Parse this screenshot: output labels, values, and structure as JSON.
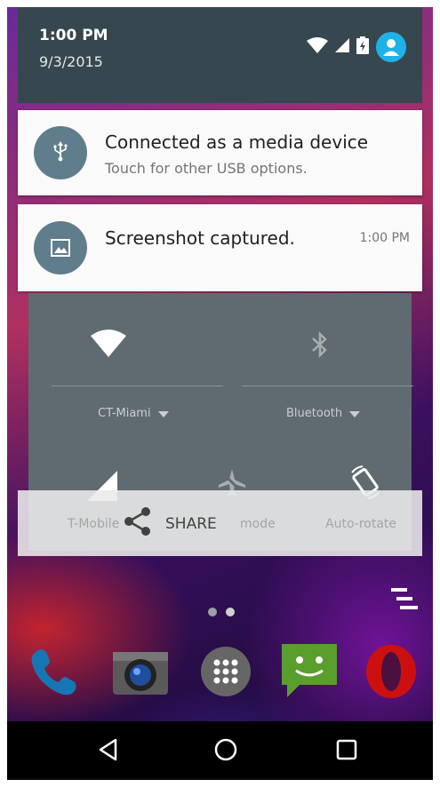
{
  "status": {
    "time": "1:00 PM",
    "date": "9/3/2015",
    "icons": [
      "wifi-icon",
      "cell-signal-icon",
      "battery-icon",
      "user-avatar-icon"
    ]
  },
  "notifications": [
    {
      "icon": "usb-icon",
      "title": "Connected as a media device",
      "subtitle": "Touch for other USB options."
    },
    {
      "icon": "image-icon",
      "title": "Screenshot captured.",
      "time": "1:00 PM"
    }
  ],
  "quick_settings": {
    "wifi_label": "CT-Miami",
    "bluetooth_label": "Bluetooth",
    "cellular_label": "T-Mobile",
    "airplane_label": "mode",
    "rotate_label": "Auto-rotate"
  },
  "share": {
    "label": "SHARE"
  },
  "dock": [
    "phone-app-icon",
    "camera-app-icon",
    "app-drawer-icon",
    "messaging-app-icon",
    "opera-app-icon"
  ],
  "colors": {
    "header_bg": "#37474f",
    "card_icon_bg": "#607d8b",
    "avatar": "#1db3e8",
    "qs_bg": "#5f6b70"
  }
}
